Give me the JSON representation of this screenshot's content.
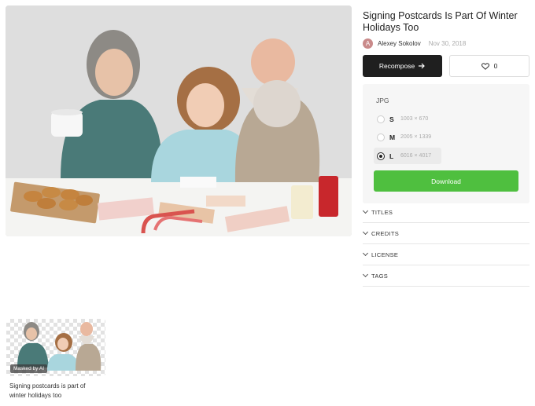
{
  "photo": {
    "subject": "grandparents and girl signing postcards"
  },
  "details": {
    "title": "Signing Postcards Is Part Of Winter Holidays Too",
    "author_initial": "A",
    "author_name": "Alexey Sokolov",
    "date": "Nov 30, 2018"
  },
  "actions": {
    "recompose_label": "Recompose",
    "recompose_icon": "arrow-right-icon",
    "like_icon": "heart-icon",
    "like_count": "0"
  },
  "download": {
    "format": "JPG",
    "sizes": [
      {
        "letter": "S",
        "dims": "1003 × 670",
        "selected": false
      },
      {
        "letter": "M",
        "dims": "2005 × 1339",
        "selected": false
      },
      {
        "letter": "L",
        "dims": "6016 × 4017",
        "selected": true
      }
    ],
    "button_label": "Download",
    "button_color": "#4fbf3f"
  },
  "sections": [
    "TITLES",
    "CREDITS",
    "LICENSE",
    "TAGS"
  ],
  "thumbnail": {
    "badge": "Masked by AI",
    "caption": "Signing postcards is part of winter holidays too"
  }
}
